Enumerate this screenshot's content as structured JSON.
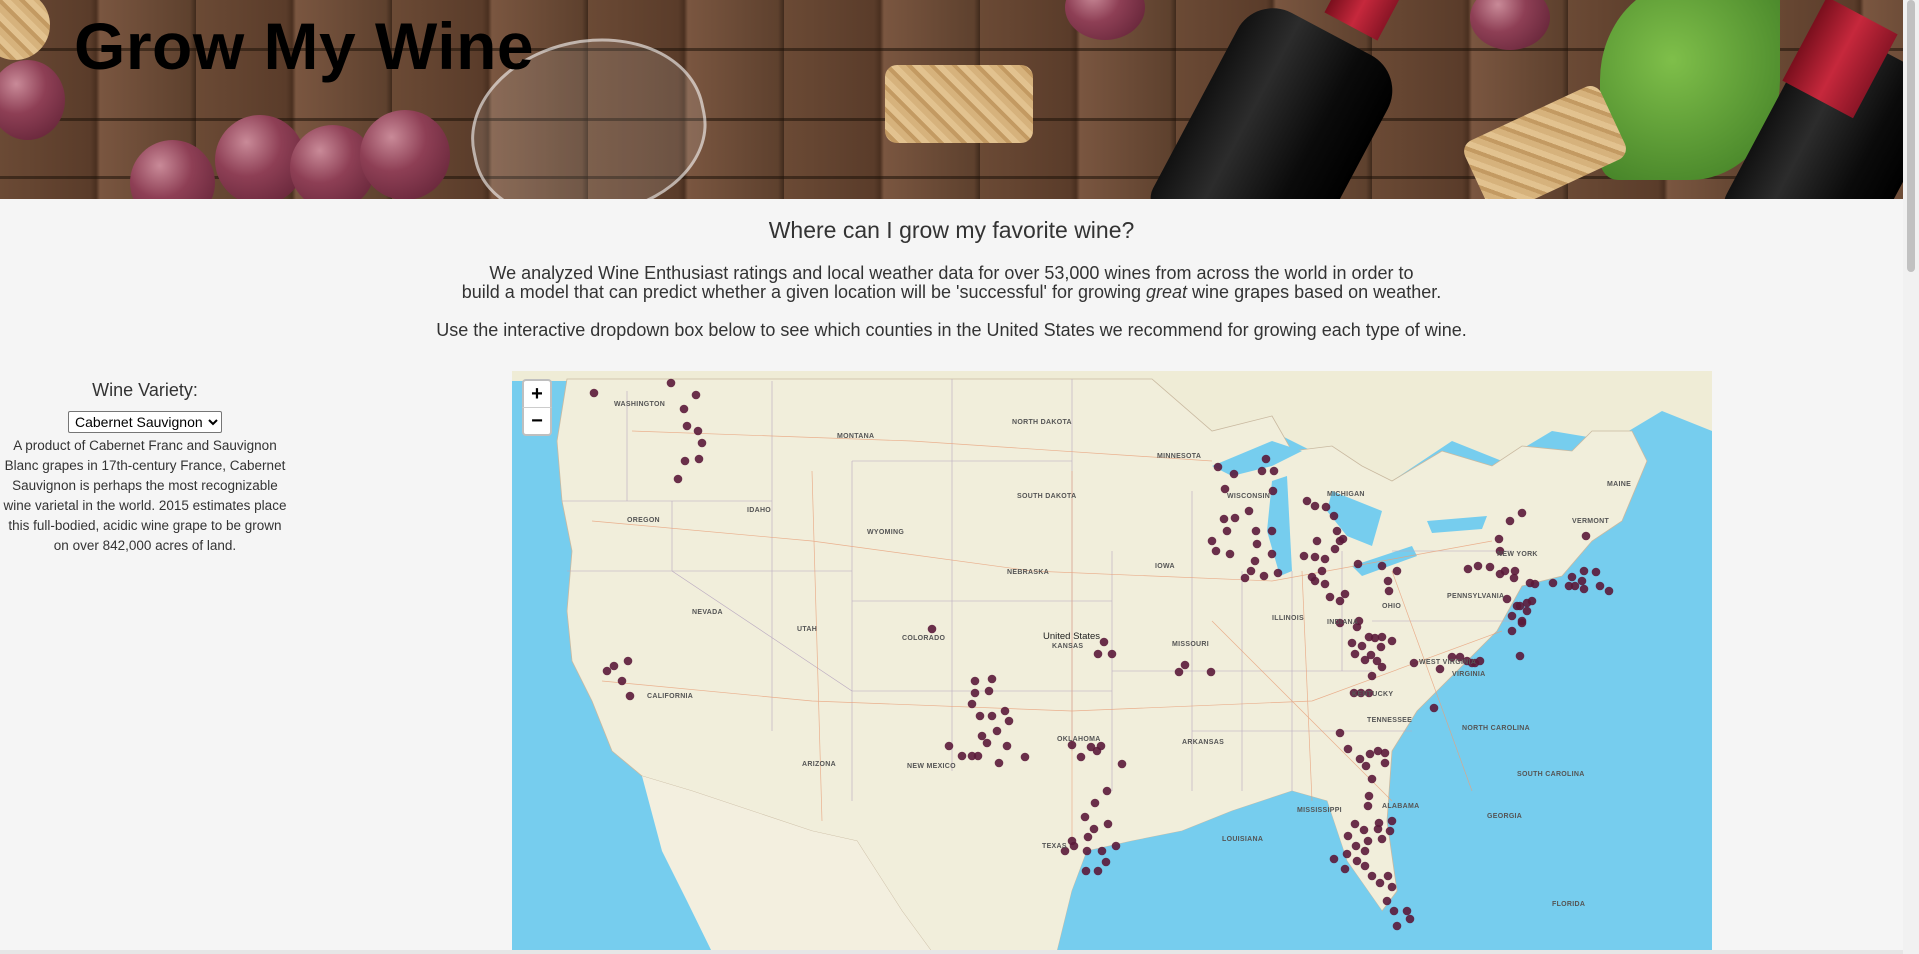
{
  "header": {
    "title": "Grow My Wine"
  },
  "intro": {
    "heading": "Where can I grow my favorite wine?",
    "p1_line1": "We analyzed Wine Enthusiast ratings and local weather data for over 53,000 wines from across the world in order to",
    "p1_line2_before": "build a model that can predict whether a given location will be 'successful' for growing ",
    "p1_line2_emph": "great",
    "p1_line2_after": " wine grapes based on weather.",
    "p2": "Use the interactive dropdown box below to see which counties in the United States we recommend for growing each type of wine."
  },
  "sidebar": {
    "label": "Wine Variety:",
    "selected": "Cabernet Sauvignon",
    "description": "A product of Cabernet Franc and Sauvignon Blanc grapes in 17th-century France, Cabernet Sauvignon is perhaps the most recognizable wine varietal in the world. 2015 estimates place this full-bodied, acidic wine grape to be grown on over 842,000 acres of land."
  },
  "map": {
    "zoom_in": "+",
    "zoom_out": "−",
    "country_label": "United States",
    "labels": [
      "WASHINGTON",
      "MONTANA",
      "NORTH DAKOTA",
      "MINNESOTA",
      "OREGON",
      "IDAHO",
      "SOUTH DAKOTA",
      "WISCONSIN",
      "MICHIGAN",
      "WYOMING",
      "IOWA",
      "NEBRASKA",
      "NEVADA",
      "UTAH",
      "COLORADO",
      "KANSAS",
      "MISSOURI",
      "ILLINOIS",
      "INDIANA",
      "OHIO",
      "PENNSYLVANIA",
      "NEW YORK",
      "CALIFORNIA",
      "ARIZONA",
      "NEW MEXICO",
      "OKLAHOMA",
      "ARKANSAS",
      "TENNESSEE",
      "KENTUCKY",
      "WEST VIRGINIA",
      "VIRGINIA",
      "NORTH CAROLINA",
      "SOUTH CAROLINA",
      "GEORGIA",
      "ALABAMA",
      "MISSISSIPPI",
      "LOUISIANA",
      "TEXAS",
      "MAINE",
      "VERMONT",
      "FLORIDA"
    ],
    "marker_color": "#5b1a3a",
    "land_color": "#f1eedb",
    "water_color": "#76cdee"
  }
}
